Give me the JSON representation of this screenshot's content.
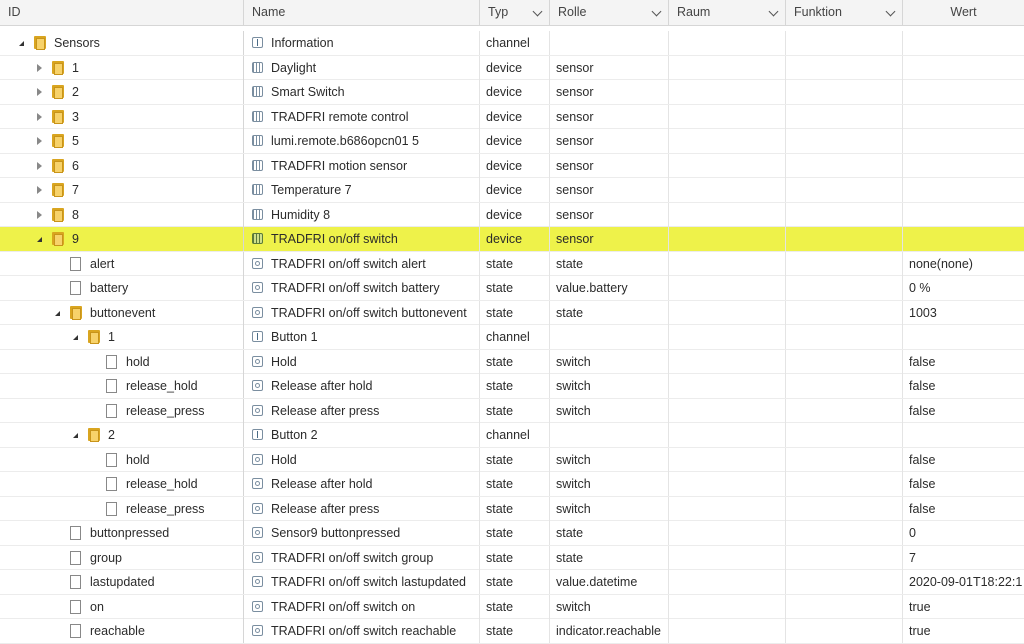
{
  "columns": {
    "id": "ID",
    "name": "Name",
    "typ": "Typ",
    "rolle": "Rolle",
    "raum": "Raum",
    "funktion": "Funktion",
    "wert": "Wert"
  },
  "rows": [
    {
      "id": "Sensors",
      "level": 1,
      "kind": "folder",
      "toggle": "expanded",
      "name": "Information",
      "icon": "channel",
      "typ": "channel",
      "rolle": "",
      "wert": ""
    },
    {
      "id": "1",
      "level": 2,
      "kind": "folder",
      "toggle": "collapsed",
      "name": "Daylight",
      "icon": "device",
      "typ": "device",
      "rolle": "sensor",
      "wert": ""
    },
    {
      "id": "2",
      "level": 2,
      "kind": "folder",
      "toggle": "collapsed",
      "name": "Smart Switch",
      "icon": "device",
      "typ": "device",
      "rolle": "sensor",
      "wert": ""
    },
    {
      "id": "3",
      "level": 2,
      "kind": "folder",
      "toggle": "collapsed",
      "name": "TRADFRI remote control",
      "icon": "device",
      "typ": "device",
      "rolle": "sensor",
      "wert": ""
    },
    {
      "id": "5",
      "level": 2,
      "kind": "folder",
      "toggle": "collapsed",
      "name": "lumi.remote.b686opcn01 5",
      "icon": "device",
      "typ": "device",
      "rolle": "sensor",
      "wert": ""
    },
    {
      "id": "6",
      "level": 2,
      "kind": "folder",
      "toggle": "collapsed",
      "name": "TRADFRI motion sensor",
      "icon": "device",
      "typ": "device",
      "rolle": "sensor",
      "wert": ""
    },
    {
      "id": "7",
      "level": 2,
      "kind": "folder",
      "toggle": "collapsed",
      "name": "Temperature 7",
      "icon": "device",
      "typ": "device",
      "rolle": "sensor",
      "wert": ""
    },
    {
      "id": "8",
      "level": 2,
      "kind": "folder",
      "toggle": "collapsed",
      "name": "Humidity 8",
      "icon": "device",
      "typ": "device",
      "rolle": "sensor",
      "wert": ""
    },
    {
      "id": "9",
      "level": 2,
      "kind": "folder",
      "toggle": "expanded",
      "name": "TRADFRI on/off switch",
      "icon": "device",
      "typ": "device",
      "rolle": "sensor",
      "wert": "",
      "highlight": true
    },
    {
      "id": "alert",
      "level": 3,
      "kind": "file",
      "name": "TRADFRI on/off switch alert",
      "icon": "state",
      "typ": "state",
      "rolle": "state",
      "wert": "none(none)"
    },
    {
      "id": "battery",
      "level": 3,
      "kind": "file",
      "name": "TRADFRI on/off switch battery",
      "icon": "state",
      "typ": "state",
      "rolle": "value.battery",
      "wert": "0 %"
    },
    {
      "id": "buttonevent",
      "level": 3,
      "kind": "folder",
      "toggle": "expanded",
      "name": "TRADFRI on/off switch buttonevent",
      "icon": "state",
      "typ": "state",
      "rolle": "state",
      "wert": "1003"
    },
    {
      "id": "1",
      "level": 4,
      "kind": "folder",
      "toggle": "expanded",
      "name": "Button 1",
      "icon": "channel",
      "typ": "channel",
      "rolle": "",
      "wert": ""
    },
    {
      "id": "hold",
      "level": 5,
      "kind": "file",
      "name": "Hold",
      "icon": "state",
      "typ": "state",
      "rolle": "switch",
      "wert": "false"
    },
    {
      "id": "release_hold",
      "level": 5,
      "kind": "file",
      "name": "Release after hold",
      "icon": "state",
      "typ": "state",
      "rolle": "switch",
      "wert": "false"
    },
    {
      "id": "release_press",
      "level": 5,
      "kind": "file",
      "name": "Release after press",
      "icon": "state",
      "typ": "state",
      "rolle": "switch",
      "wert": "false"
    },
    {
      "id": "2",
      "level": 4,
      "kind": "folder",
      "toggle": "expanded",
      "name": "Button 2",
      "icon": "channel",
      "typ": "channel",
      "rolle": "",
      "wert": ""
    },
    {
      "id": "hold",
      "level": 5,
      "kind": "file",
      "name": "Hold",
      "icon": "state",
      "typ": "state",
      "rolle": "switch",
      "wert": "false"
    },
    {
      "id": "release_hold",
      "level": 5,
      "kind": "file",
      "name": "Release after hold",
      "icon": "state",
      "typ": "state",
      "rolle": "switch",
      "wert": "false"
    },
    {
      "id": "release_press",
      "level": 5,
      "kind": "file",
      "name": "Release after press",
      "icon": "state",
      "typ": "state",
      "rolle": "switch",
      "wert": "false"
    },
    {
      "id": "buttonpressed",
      "level": 3,
      "kind": "file",
      "name": "Sensor9 buttonpressed",
      "icon": "state",
      "typ": "state",
      "rolle": "state",
      "wert": "0"
    },
    {
      "id": "group",
      "level": 3,
      "kind": "file",
      "name": "TRADFRI on/off switch group",
      "icon": "state",
      "typ": "state",
      "rolle": "state",
      "wert": "7"
    },
    {
      "id": "lastupdated",
      "level": 3,
      "kind": "file",
      "name": "TRADFRI on/off switch lastupdated",
      "icon": "state",
      "typ": "state",
      "rolle": "value.datetime",
      "wert": "2020-09-01T18:22:1"
    },
    {
      "id": "on",
      "level": 3,
      "kind": "file",
      "name": "TRADFRI on/off switch on",
      "icon": "state",
      "typ": "state",
      "rolle": "switch",
      "wert": "true"
    },
    {
      "id": "reachable",
      "level": 3,
      "kind": "file",
      "name": "TRADFRI on/off switch reachable",
      "icon": "state",
      "typ": "state",
      "rolle": "indicator.reachable",
      "wert": "true"
    }
  ],
  "colors": {
    "highlight": "#eef24a",
    "folder": "#f7d26a"
  }
}
